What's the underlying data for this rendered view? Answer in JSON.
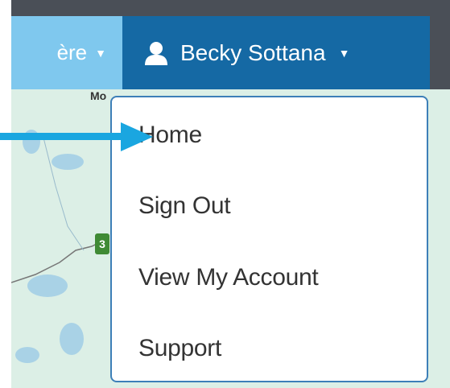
{
  "header": {
    "language_label": "ère",
    "user_name": "Becky Sottana"
  },
  "menu": {
    "items": [
      {
        "label": "Home"
      },
      {
        "label": "Sign Out"
      },
      {
        "label": "View My Account"
      },
      {
        "label": "Support"
      }
    ]
  },
  "map": {
    "label": "Mo",
    "road_number": "3"
  },
  "colors": {
    "user_button": "#1569a4",
    "language_button": "#7fc8ee",
    "topbar": "#4a4f57",
    "dropdown_border": "#3d7fb8",
    "arrow": "#1aa6e0"
  },
  "icons": {
    "user": "user-icon",
    "caret": "caret-down-icon",
    "annotation": "arrow-right-icon"
  }
}
